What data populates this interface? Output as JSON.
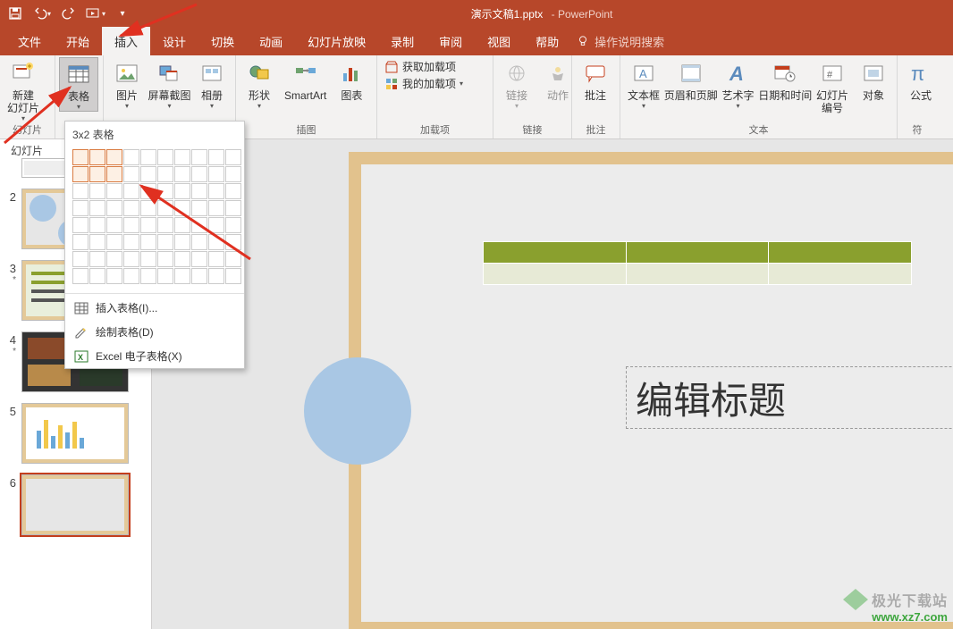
{
  "app": {
    "doc_title": "演示文稿1.pptx",
    "app_name": "PowerPoint"
  },
  "menu": {
    "file": "文件",
    "home": "开始",
    "insert": "插入",
    "design": "设计",
    "transitions": "切换",
    "animations": "动画",
    "slideshow": "幻灯片放映",
    "record": "录制",
    "review": "审阅",
    "view": "视图",
    "help": "帮助",
    "tell_me": "操作说明搜索"
  },
  "ribbon": {
    "new_slide": "新建\n幻灯片",
    "slides_group": "幻灯片",
    "table": "表格",
    "pictures": "图片",
    "screenshot": "屏幕截图",
    "album": "相册",
    "illust_group": "插图",
    "shapes": "形状",
    "smartart": "SmartArt",
    "chart": "图表",
    "get_addins": "获取加载项",
    "my_addins": "我的加载项",
    "addins_group": "加载项",
    "link": "链接",
    "action": "动作",
    "links_group": "链接",
    "comment": "批注",
    "comment_group": "批注",
    "textbox": "文本框",
    "headerfooter": "页眉和页脚",
    "wordart": "艺术字",
    "datetime": "日期和时间",
    "slidenum": "幻灯片\n编号",
    "object": "对象",
    "text_group": "文本",
    "equation": "公式",
    "symbols_group": "符"
  },
  "dropdown": {
    "title": "3x2 表格",
    "insert_table": "插入表格(I)...",
    "draw_table": "绘制表格(D)",
    "excel_sheet": "Excel 电子表格(X)",
    "sel_cols": 3,
    "sel_rows": 2
  },
  "slide": {
    "title_placeholder": "编辑标题"
  },
  "thumbs": {
    "panel_label": "幻灯片",
    "numbers": [
      "2",
      "3",
      "4",
      "5",
      "6"
    ]
  },
  "watermark": {
    "brand": "极光下载站",
    "url": "www.xz7.com"
  }
}
